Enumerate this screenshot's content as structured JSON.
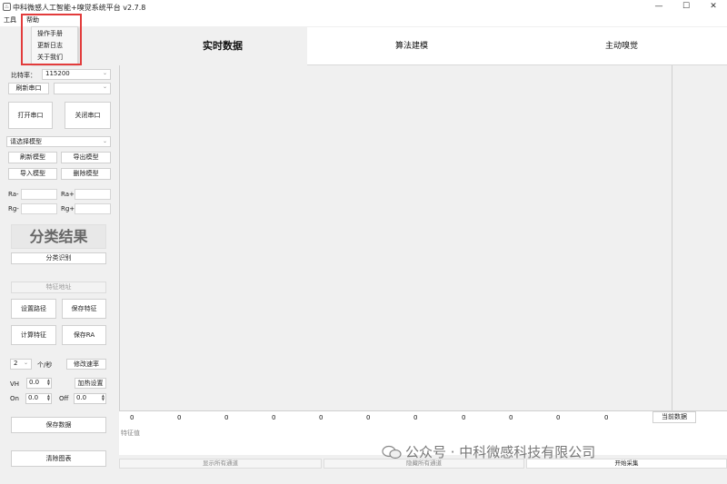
{
  "window": {
    "title": "中科微感人工智能+嗅觉系统平台 v2.7.8",
    "min": "—",
    "max": "☐",
    "close": "✕"
  },
  "menu": {
    "tools": "工具",
    "help": "帮助",
    "help_items": [
      "操作手册",
      "更新日志",
      "关于我们"
    ]
  },
  "tabs": [
    "实时数据",
    "算法建模",
    "主动嗅觉"
  ],
  "left": {
    "baud_label": "比特率：",
    "baud_value": "115200",
    "refresh_port": "刷新串口",
    "open_port": "打开串口",
    "close_port": "关闭串口",
    "model_select": "请选择模型",
    "refresh_model": "刷新模型",
    "export_model": "导出模型",
    "import_model": "导入模型",
    "delete_model": "删除模型",
    "ra_minus": "Ra-",
    "ra_plus": "Ra+",
    "rg_minus": "Rg-",
    "rg_plus": "Rg+",
    "result_title": "分类结果",
    "classify": "分类识别",
    "feature_addr": "特征地址",
    "set_path": "设置路径",
    "save_feature": "保存特征",
    "calc_feature": "计算特征",
    "save_ra": "保存RA",
    "rate_value": "2",
    "rate_unit": "个/秒",
    "modify_rate": "修改速率",
    "vh_label": "VH",
    "vh_value": "0.0",
    "heat_set": "加热设置",
    "on_label": "On",
    "on_value": "0.0",
    "off_label": "Off",
    "off_value": "0.0",
    "save_data": "保存数据",
    "clear_chart": "清除图表"
  },
  "readout": {
    "values": [
      "0",
      "0",
      "0",
      "0",
      "0",
      "0",
      "0",
      "0",
      "0",
      "0",
      "0"
    ],
    "current_data": "当前数据",
    "feature_value": "特征值",
    "show_all": "显示所有通道",
    "hide_all": "隐藏所有通道",
    "start_collect": "开始采集"
  },
  "watermark": "公众号 · 中科微感科技有限公司"
}
